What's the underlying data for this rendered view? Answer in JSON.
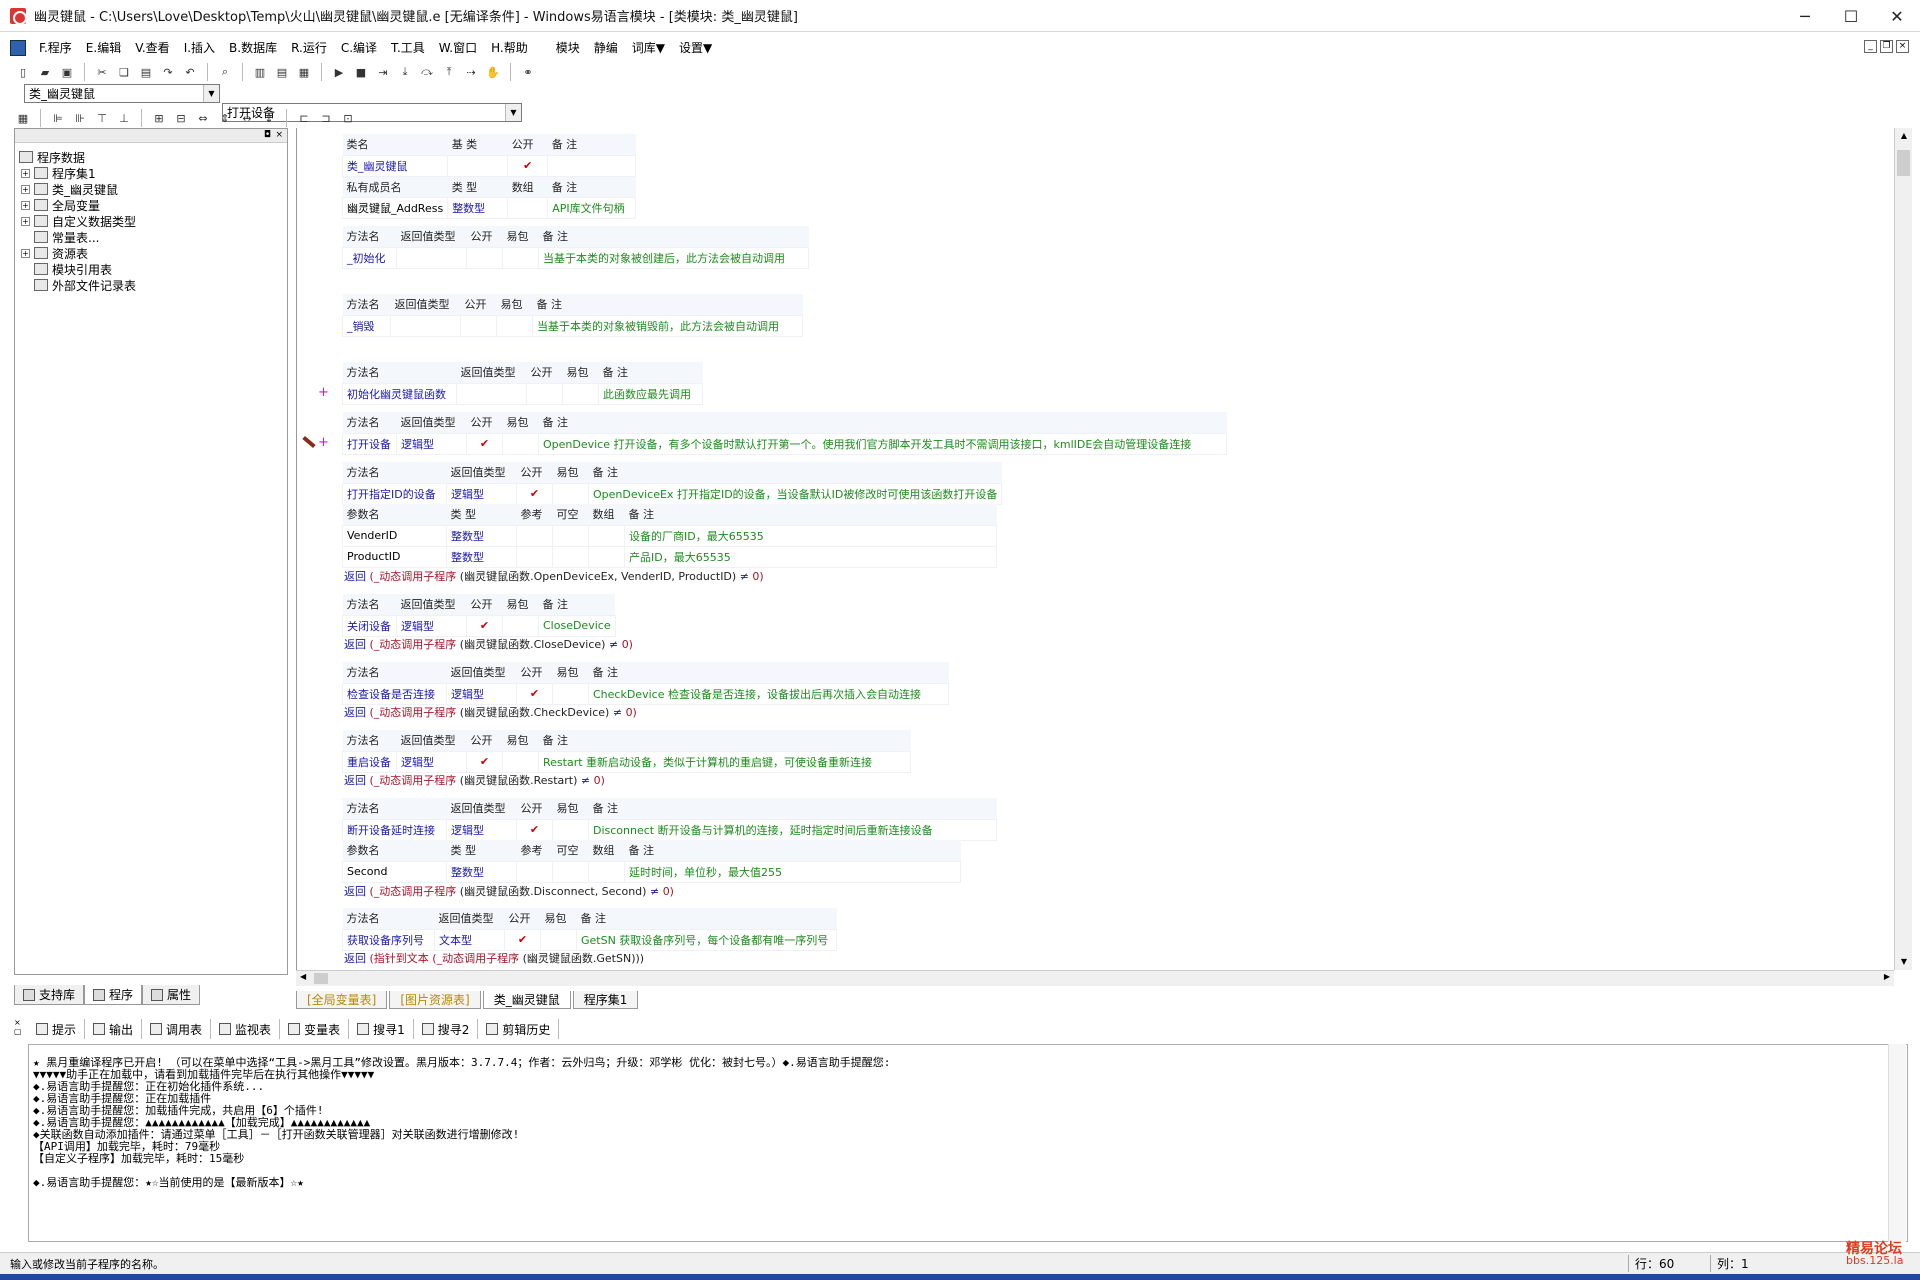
{
  "window": {
    "title": "幽灵键鼠 - C:\\Users\\Love\\Desktop\\Temp\\火山\\幽灵键鼠\\幽灵键鼠.e [无编译条件] - Windows易语言模块 - [类模块: 类_幽灵键鼠]",
    "minimize": "─",
    "maximize": "☐",
    "close": "✕"
  },
  "menu": [
    "F.程序",
    "E.编辑",
    "V.查看",
    "I.插入",
    "B.数据库",
    "R.运行",
    "C.编译",
    "T.工具",
    "W.窗口",
    "H.帮助",
    "模块",
    "静编",
    "词库▼",
    "设置▼"
  ],
  "combos": {
    "left": "类_幽灵键鼠",
    "right": "打开设备"
  },
  "tree": [
    {
      "label": "程序数据",
      "level": 0,
      "exp": ""
    },
    {
      "label": "程序集1",
      "level": 1,
      "exp": "+"
    },
    {
      "label": "类_幽灵键鼠",
      "level": 1,
      "exp": "+"
    },
    {
      "label": "全局变量",
      "level": 1,
      "exp": "+"
    },
    {
      "label": "自定义数据类型",
      "level": 1,
      "exp": "+"
    },
    {
      "label": "常量表...",
      "level": 1,
      "exp": ""
    },
    {
      "label": "资源表",
      "level": 1,
      "exp": "+"
    },
    {
      "label": "模块引用表",
      "level": 1,
      "exp": ""
    },
    {
      "label": "外部文件记录表",
      "level": 1,
      "exp": ""
    }
  ],
  "left_tabs": [
    "支持库",
    "程序",
    "属性"
  ],
  "code": {
    "class_hdr": [
      "类名",
      "基 类",
      "公开",
      "备 注"
    ],
    "class_row": {
      "name": "类_幽灵键鼠",
      "check": "✔"
    },
    "member_hdr": [
      "私有成员名",
      "类 型",
      "数组",
      "备 注"
    ],
    "member_row": {
      "name": "幽灵键鼠_AddRess",
      "type": "整数型",
      "comment": "API库文件句柄"
    },
    "method_hdr": [
      "方法名",
      "返回值类型",
      "公开",
      "易包",
      "备 注"
    ],
    "param_hdr": [
      "参数名",
      "类 型",
      "参考",
      "可空",
      "数组",
      "备 注"
    ],
    "methods": {
      "init": {
        "name": "_初始化",
        "comment": "当基于本类的对象被创建后，此方法会被自动调用"
      },
      "destroy": {
        "name": "_销毁",
        "comment": "当基于本类的对象被销毁前，此方法会被自动调用"
      },
      "initfn": {
        "name": "初始化幽灵键鼠函数",
        "comment": "此函数应最先调用"
      },
      "open": {
        "name": "打开设备",
        "type": "逻辑型",
        "check": "✔",
        "comment": "OpenDevice 打开设备，有多个设备时默认打开第一个。使用我们官方脚本开发工具时不需调用该接口，kmlIDE会自动管理设备连接"
      },
      "openid": {
        "name": "打开指定ID的设备",
        "type": "逻辑型",
        "check": "✔",
        "comment": "OpenDeviceEx 打开指定ID的设备，当设备默认ID被修改时可使用该函数打开设备"
      },
      "openid_p1": {
        "name": "VenderID",
        "type": "整数型",
        "comment": "设备的厂商ID，最大65535"
      },
      "openid_p2": {
        "name": "ProductID",
        "type": "整数型",
        "comment": "产品ID，最大65535"
      },
      "close": {
        "name": "关闭设备",
        "type": "逻辑型",
        "check": "✔",
        "comment": "CloseDevice"
      },
      "check": {
        "name": "检查设备是否连接",
        "type": "逻辑型",
        "check": "✔",
        "comment": "CheckDevice 检查设备是否连接，设备拔出后再次插入会自动连接"
      },
      "restart": {
        "name": "重启设备",
        "type": "逻辑型",
        "check": "✔",
        "comment": "Restart 重新启动设备，类似于计算机的重启键，可使设备重新连接"
      },
      "disconnect": {
        "name": "断开设备延时连接",
        "type": "逻辑型",
        "check": "✔",
        "comment": "Disconnect 断开设备与计算机的连接，延时指定时间后重新连接设备"
      },
      "disconnect_p1": {
        "name": "Second",
        "type": "整数型",
        "comment": "延时时间，单位秒，最大值255"
      },
      "getsn": {
        "name": "获取设备序列号",
        "type": "文本型",
        "check": "✔",
        "comment": "GetSN 获取设备序列号，每个设备都有唯一序列号"
      }
    },
    "returns": {
      "kw": "返回",
      "call": "(_动态调用子程序",
      "openid": "(幽灵键鼠函数.OpenDeviceEx, VenderID, ProductID)",
      "close": "(幽灵键鼠函数.CloseDevice)",
      "check": "(幽灵键鼠函数.CheckDevice)",
      "restart": "(幽灵键鼠函数.Restart)",
      "disconnect": "(幽灵键鼠函数.Disconnect, Second)",
      "getsn_pre": "(指针到文本",
      "getsn": "(幽灵键鼠函数.GetSN)))",
      "op": "≠",
      "zero": "0)"
    }
  },
  "doc_tabs": [
    "[全局变量表]",
    "[图片资源表]",
    "类_幽灵键鼠",
    "程序集1"
  ],
  "bottom_tools": [
    "提示",
    "输出",
    "调用表",
    "监视表",
    "变量表",
    "搜寻1",
    "搜寻2",
    "剪辑历史"
  ],
  "output_lines": [
    "★ 黑月重编译程序已开启! （可以在菜单中选择“工具->黑月工具”修改设置。黑月版本：3.7.7.4；作者：云外归鸟；升级：邓学彬 优化：被封七号。）◆.易语言助手提醒您:",
    "▼▼▼▼▼助手正在加载中，请看到加载插件完毕后在执行其他操作▼▼▼▼▼",
    "◆.易语言助手提醒您：正在初始化插件系统...",
    "◆.易语言助手提醒您：正在加载插件",
    "◆.易语言助手提醒您：加载插件完成，共启用【6】个插件!",
    "◆.易语言助手提醒您：▲▲▲▲▲▲▲▲▲▲▲▲【加载完成】▲▲▲▲▲▲▲▲▲▲▲▲",
    "◆关联函数自动添加插件：请通过菜单［工具］－［打开函数关联管理器］对关联函数进行增删修改!",
    "【API调用】加载完毕，耗时：79毫秒",
    "【自定义子程序】加载完毕，耗时：15毫秒",
    "",
    "◆.易语言助手提醒您：★☆当前使用的是【最新版本】☆★"
  ],
  "status": {
    "text": "输入或修改当前子程序的名称。",
    "line": "行：60",
    "col": "列：1"
  },
  "watermark": {
    "line1": "精易论坛",
    "line2": "bbs.125.la"
  }
}
